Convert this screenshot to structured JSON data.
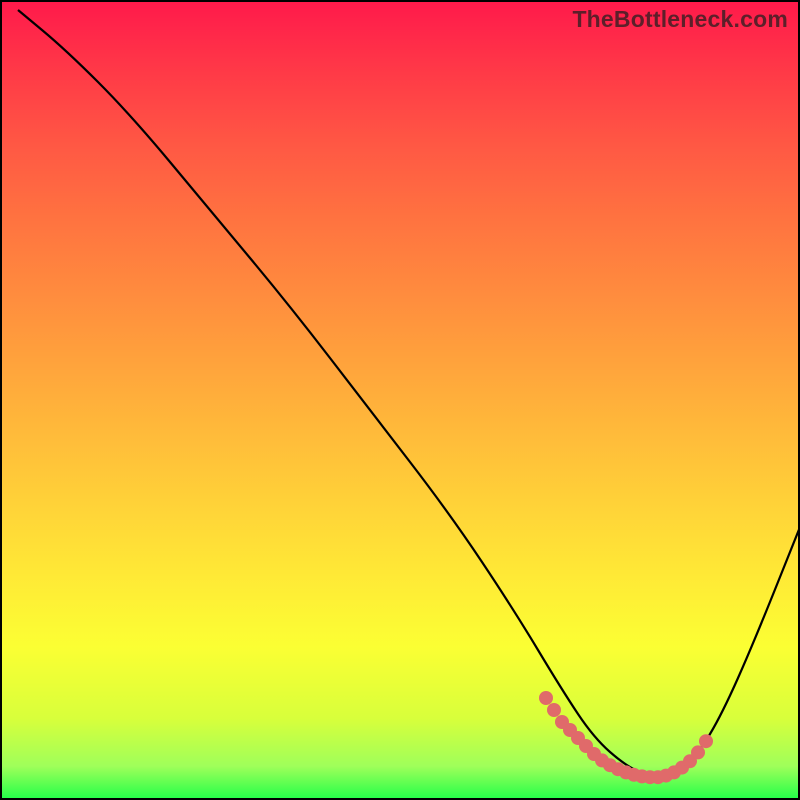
{
  "watermark": "TheBottleneck.com",
  "chart_data": {
    "type": "line",
    "title": "",
    "xlabel": "",
    "ylabel": "",
    "xlim": [
      0,
      100
    ],
    "ylim": [
      0,
      100
    ],
    "note": "Axes are unlabeled; values estimated from pixel positions on 800×800 canvas. Curve descends steeply from upper-left, flattens near bottom ~x=70–85, then rises toward bottom-right corner.",
    "series": [
      {
        "name": "main-curve",
        "color": "#000000",
        "x": [
          2,
          8,
          14,
          20,
          26,
          32,
          38,
          44,
          50,
          56,
          62,
          68,
          72,
          76,
          80,
          84,
          88,
          92,
          96,
          100
        ],
        "y": [
          99,
          93,
          86,
          78,
          70,
          62,
          54,
          46,
          38,
          30,
          22,
          14,
          9,
          5,
          3,
          3,
          7,
          14,
          24,
          35
        ]
      },
      {
        "name": "highlight-segment",
        "color": "#e06a6a",
        "x": [
          68,
          70,
          72,
          74,
          76,
          78,
          80,
          82,
          84,
          86,
          88
        ],
        "y": [
          13,
          10,
          8,
          6,
          4.5,
          3.5,
          3,
          3.2,
          4,
          5.5,
          8
        ]
      }
    ],
    "highlight_dots": {
      "color": "#e06a6a",
      "radius_px": 7,
      "points_xy": [
        [
          68,
          13
        ],
        [
          69,
          11.5
        ],
        [
          70,
          10
        ],
        [
          71,
          9
        ],
        [
          72,
          8
        ],
        [
          73,
          7
        ],
        [
          74,
          6
        ],
        [
          75,
          5.2
        ],
        [
          76,
          4.6
        ],
        [
          77,
          4.1
        ],
        [
          78,
          3.7
        ],
        [
          79,
          3.4
        ],
        [
          80,
          3.2
        ],
        [
          81,
          3.1
        ],
        [
          82,
          3.1
        ],
        [
          83,
          3.3
        ],
        [
          84,
          3.7
        ],
        [
          85,
          4.3
        ],
        [
          86,
          5.1
        ],
        [
          87,
          6.2
        ],
        [
          88,
          7.6
        ]
      ]
    }
  }
}
